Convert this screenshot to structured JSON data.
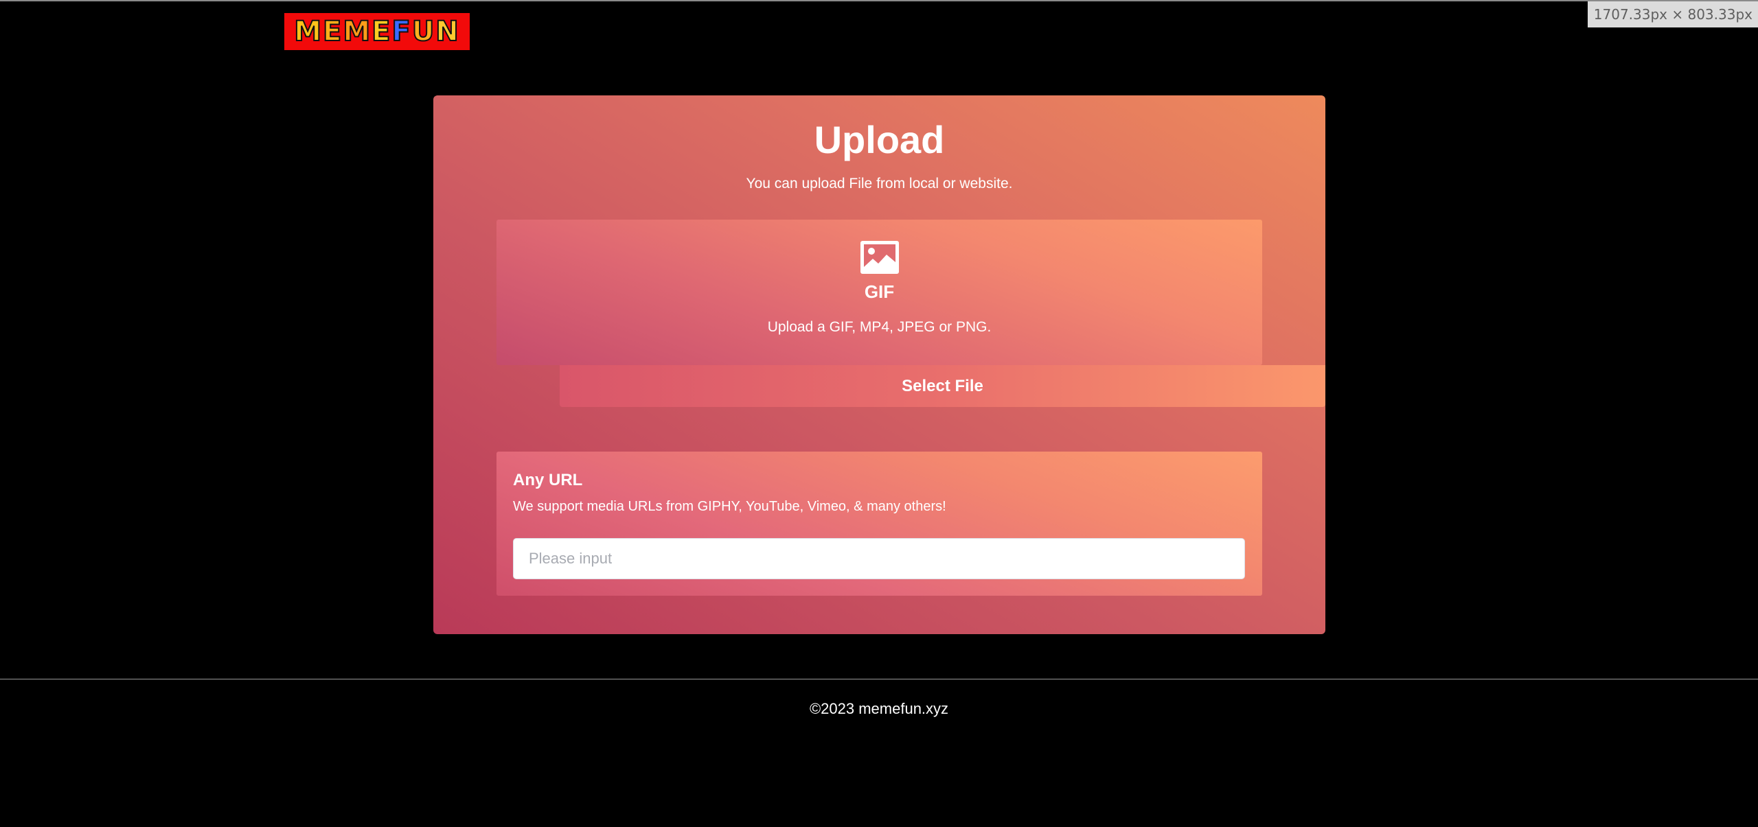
{
  "overlay": {
    "dimensions": "1707.33px × 803.33px"
  },
  "header": {
    "logo_text": "MEMEFUN",
    "logo_letters": [
      "M",
      "E",
      "M",
      "E",
      "F",
      "U",
      "N"
    ]
  },
  "upload": {
    "title": "Upload",
    "subtitle": "You can upload File from local or website.",
    "file_box": {
      "icon": "image-icon",
      "label": "GIF",
      "hint": "Upload a GIF, MP4, JPEG or PNG.",
      "button_label": "Select File"
    },
    "url_box": {
      "title": "Any URL",
      "description": "We support media URLs from GIPHY, YouTube, Vimeo, & many others!",
      "input_placeholder": "Please input",
      "input_value": ""
    }
  },
  "footer": {
    "copyright": "©2023 memefun.xyz"
  },
  "colors": {
    "background": "#000000",
    "card_gradient_start": "#b93a58",
    "card_gradient_end": "#ee8a5c",
    "logo_background": "#f20a0a"
  }
}
